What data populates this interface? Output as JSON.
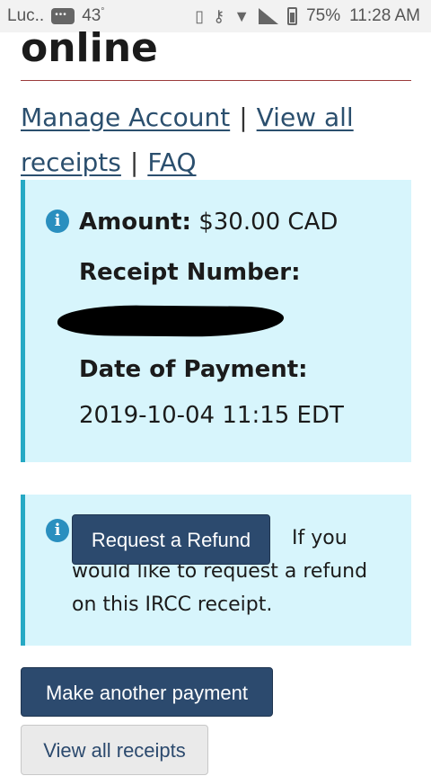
{
  "status_bar": {
    "carrier": "Luc..",
    "temperature": "43",
    "temp_unit": "°",
    "battery": "75%",
    "time": "11:28 AM"
  },
  "header": {
    "title": "online"
  },
  "links": {
    "manage_account": "Manage Account",
    "separator": "|",
    "view_all_receipts": "View all receipts",
    "faq": "FAQ"
  },
  "receipt": {
    "amount_label": "Amount:",
    "amount_value": "$30.00 CAD",
    "receipt_number_label": "Receipt Number:",
    "date_label": "Date of Payment:",
    "date_value": "2019-10-04 11:15 EDT"
  },
  "refund": {
    "button_label": "Request a Refund",
    "text": "If you would like to request a refund on this IRCC receipt."
  },
  "actions": {
    "make_another_payment": "Make another payment",
    "view_all_receipts": "View all receipts"
  },
  "colors": {
    "primary_button": "#2c4a6e",
    "alert_background": "#d7f5fc",
    "alert_border": "#26a9c4",
    "link": "#2b4f6e"
  },
  "icons": [
    "info-icon",
    "messages-icon",
    "vibrate-icon",
    "vpn-key-icon",
    "wifi-icon",
    "signal-icon",
    "battery-icon"
  ]
}
